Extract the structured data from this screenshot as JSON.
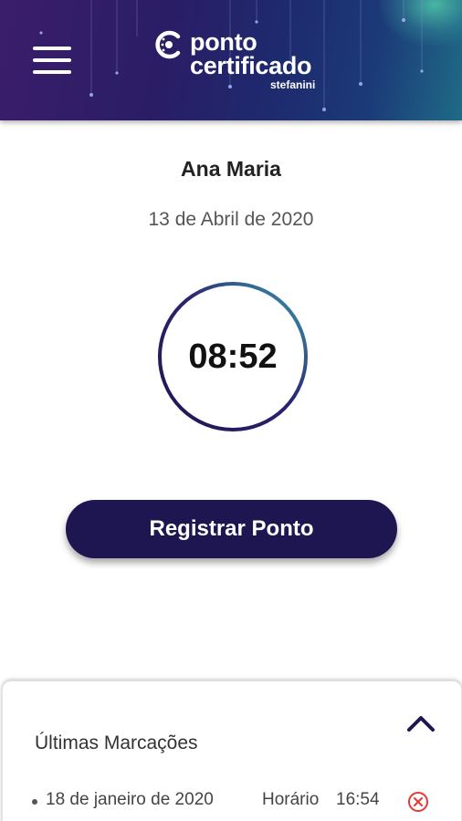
{
  "header": {
    "menu_icon": "hamburger-menu-icon",
    "logo_icon": "ponto-certificado-logo-icon",
    "logo_line1": "ponto",
    "logo_line2": "certificado",
    "logo_line3": "stefanini",
    "colors": {
      "gradient_start": "#3b1d6b",
      "gradient_end": "#1f6b86"
    }
  },
  "user": {
    "name": "Ana Maria",
    "date": "13 de Abril de 2020"
  },
  "clock": {
    "time": "08:52",
    "ring_colors": [
      "#1e1650",
      "#3a9fb0"
    ]
  },
  "register_button": {
    "label": "Registrar Ponto",
    "color": "#1e1650"
  },
  "recent_panel": {
    "title": "Últimas Marcações",
    "toggle_icon": "chevron-up-icon",
    "entries": [
      {
        "date": "18 de janeiro de 2020",
        "label": "Horário",
        "time": "16:54",
        "delete_icon": "close-circle-icon",
        "delete_color": "#e53935"
      }
    ]
  }
}
